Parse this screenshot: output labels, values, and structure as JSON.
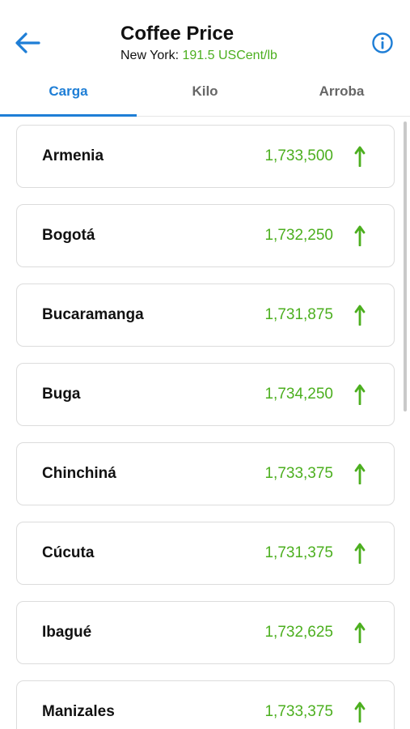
{
  "header": {
    "title": "Coffee Price",
    "subtitle_label": "New York:",
    "subtitle_value": "191.5 USCent/lb"
  },
  "tabs": [
    {
      "label": "Carga",
      "active": true
    },
    {
      "label": "Kilo",
      "active": false
    },
    {
      "label": "Arroba",
      "active": false
    }
  ],
  "prices": [
    {
      "city": "Armenia",
      "value": "1,733,500",
      "trend": "up"
    },
    {
      "city": "Bogotá",
      "value": "1,732,250",
      "trend": "up"
    },
    {
      "city": "Bucaramanga",
      "value": "1,731,875",
      "trend": "up"
    },
    {
      "city": "Buga",
      "value": "1,734,250",
      "trend": "up"
    },
    {
      "city": "Chinchiná",
      "value": "1,733,375",
      "trend": "up"
    },
    {
      "city": "Cúcuta",
      "value": "1,731,375",
      "trend": "up"
    },
    {
      "city": "Ibagué",
      "value": "1,732,625",
      "trend": "up"
    },
    {
      "city": "Manizales",
      "value": "1,733,375",
      "trend": "up"
    }
  ],
  "icons": {
    "back": "arrow-left-icon",
    "info": "info-icon",
    "trend_up": "arrow-up-icon"
  },
  "colors": {
    "accent": "#1e7ed6",
    "positive": "#4caf1f"
  }
}
